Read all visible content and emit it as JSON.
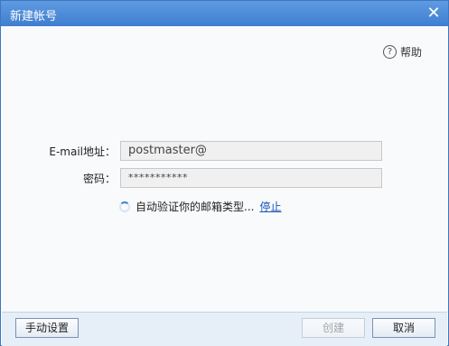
{
  "window": {
    "title": "新建帐号",
    "close_symbol": "✕"
  },
  "help": {
    "icon_symbol": "?",
    "label": "帮助"
  },
  "form": {
    "email_label": "E-mail地址：",
    "email_value": "postmaster@",
    "password_label": "密码：",
    "password_value": "***********"
  },
  "status": {
    "text": "自动验证你的邮箱类型...",
    "stop_label": "停止"
  },
  "footer": {
    "manual_settings_label": "手动设置",
    "create_label": "创建",
    "cancel_label": "取消"
  },
  "colors": {
    "titlebar": "#4a86d6",
    "link": "#1a56b8"
  }
}
